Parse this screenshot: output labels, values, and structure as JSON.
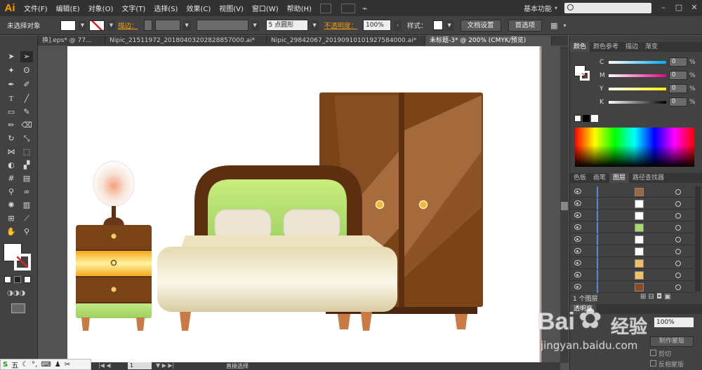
{
  "app": {
    "logo": "Ai",
    "menu": [
      "文件(F)",
      "编辑(E)",
      "对象(O)",
      "文字(T)",
      "选择(S)",
      "效果(C)",
      "视图(V)",
      "窗口(W)",
      "帮助(H)"
    ],
    "workspace": "基本功能"
  },
  "control": {
    "selection_label": "未选择对象",
    "stroke_label": "描边：",
    "brush_label": "5 点圆形",
    "opacity_label": "不透明度：",
    "opacity_value": "100%",
    "style_label": "样式：",
    "doc_setup_button": "文档设置",
    "preferences_button": "首选项"
  },
  "tabs": [
    {
      "label": "换].eps* @ 77..."
    },
    {
      "label": "Nipic_21511972_20180403202828857000.ai*"
    },
    {
      "label": "Nipic_29842067_20190910101927584000.ai*"
    },
    {
      "label": "未标题-3* @ 200% (CMYK/预览)"
    }
  ],
  "color_panel": {
    "tabs": [
      "颜色",
      "颜色参考",
      "描边",
      "渐变"
    ],
    "channels": [
      {
        "name": "C",
        "value": "0",
        "unit": "%",
        "track": "#00aeef"
      },
      {
        "name": "M",
        "value": "0",
        "unit": "%",
        "track": "#ec008c"
      },
      {
        "name": "Y",
        "value": "0",
        "unit": "%",
        "track": "#fff200"
      },
      {
        "name": "K",
        "value": "0",
        "unit": "%",
        "track": "#000000"
      }
    ]
  },
  "layers_panel": {
    "tabs": [
      "色板",
      "画笔",
      "图层",
      "路径查找器"
    ],
    "rows": [
      {
        "thumb": "#a0653a"
      },
      {
        "thumb": "#ffffff"
      },
      {
        "thumb": "#ffffff"
      },
      {
        "thumb": "#a9d86e"
      },
      {
        "thumb": "#ffffff"
      },
      {
        "thumb": "#ffffff"
      },
      {
        "thumb": "#f2c060"
      },
      {
        "thumb": "#f2c060"
      },
      {
        "thumb": "#8b4a22"
      },
      {
        "thumb": "#8b4a22"
      }
    ],
    "count_label": "1 个图层",
    "bottom_tabs": "透明度",
    "opacity_value": "100%",
    "make_mask": "制作蒙版",
    "clip": "剪切",
    "invert": "反相蒙版"
  },
  "status": {
    "zoom_page": "1",
    "tool_label": "直接选择"
  },
  "ime": {
    "mode": "五"
  },
  "watermark": {
    "brand": "Bai",
    "brand2": "经验",
    "url": "jingyan.baidu.com"
  },
  "colors": {
    "wood": "#7a4418",
    "wood_dark": "#5b2f10",
    "headboard_green": "#a9d86e",
    "mattress": "#ddd2a8",
    "pillow": "#ece5d4",
    "knob": "#f5b63a"
  }
}
